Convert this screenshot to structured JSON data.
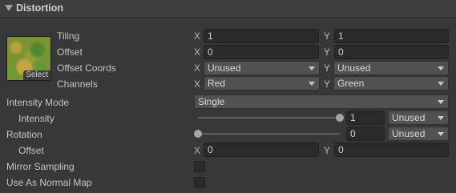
{
  "section": {
    "title": "Distortion"
  },
  "texture": {
    "select_label": "Select"
  },
  "rows": {
    "tiling": {
      "label": "Tiling",
      "x_axis": "X",
      "x": "1",
      "y_axis": "Y",
      "y": "1"
    },
    "offset": {
      "label": "Offset",
      "x_axis": "X",
      "x": "0",
      "y_axis": "Y",
      "y": "0"
    },
    "offset_coords": {
      "label": "Offset Coords",
      "x_axis": "X",
      "x": "Unused",
      "y_axis": "Y",
      "y": "Unused"
    },
    "channels": {
      "label": "Channels",
      "x_axis": "X",
      "x": "Red",
      "y_axis": "Y",
      "y": "Green"
    },
    "intensity_mode": {
      "label": "Intensity Mode",
      "value": "Single"
    },
    "intensity": {
      "label": "Intensity",
      "value": "1",
      "slider_fraction": 1.0,
      "mode": "Unused"
    },
    "rotation": {
      "label": "Rotation",
      "value": "0",
      "slider_fraction": 0.0,
      "mode": "Unused"
    },
    "rotation_offset": {
      "label": "Offset",
      "x_axis": "X",
      "x": "0",
      "y_axis": "Y",
      "y": "0"
    },
    "mirror_sampling": {
      "label": "Mirror Sampling",
      "checked": false
    },
    "normal_map": {
      "label": "Use As Normal Map",
      "checked": false
    }
  },
  "colors": {
    "background": "#383838",
    "header": "#3e3e3e",
    "field": "#2a2a2a",
    "dropdown": "#515151"
  }
}
